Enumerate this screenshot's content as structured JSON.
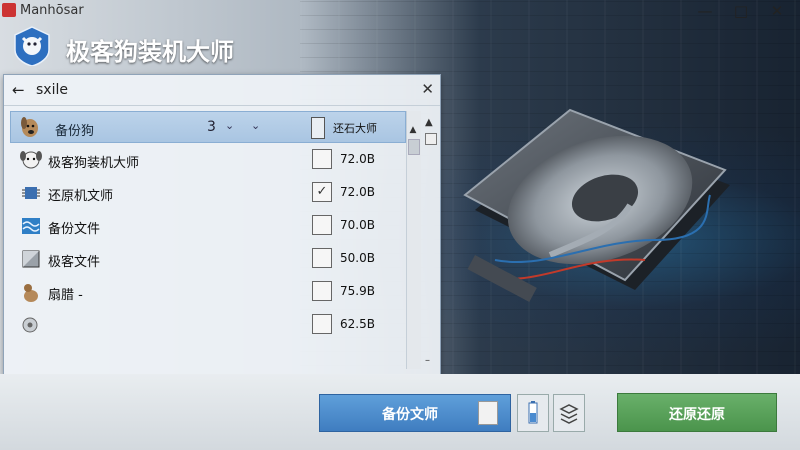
{
  "window": {
    "app_name": "Manhōsar",
    "controls": {
      "minimize": "—",
      "maximize": "□",
      "close": "✕"
    }
  },
  "brand": {
    "title": "极客狗装机大师"
  },
  "panel": {
    "back_icon": "←",
    "title": "sxile",
    "close_icon": "✕",
    "selected_row": {
      "label": "备份狗",
      "count": "3",
      "chevron1": "⌄",
      "chevron2": "⌄",
      "column_label": "还石大师"
    },
    "rows": [
      {
        "icon": "dog-face-icon",
        "label": "极客狗装机大师",
        "checked": false,
        "size": "72.0B"
      },
      {
        "icon": "chip-icon",
        "label": "还原机文师",
        "checked": true,
        "size": "72.0B"
      },
      {
        "icon": "wave-file-icon",
        "label": "备份文件",
        "checked": false,
        "size": "70.0B"
      },
      {
        "icon": "cube-icon",
        "label": "极客文件",
        "checked": false,
        "size": "50.0B"
      },
      {
        "icon": "dog-sit-icon",
        "label": "扇腊 -",
        "checked": false,
        "size": "75.9B"
      },
      {
        "icon": "gear-badge-icon",
        "label": "",
        "checked": false,
        "size": "62.5B"
      }
    ],
    "check_mark": "✓",
    "scroll": {
      "up": "▲",
      "down": "–"
    }
  },
  "bottom": {
    "backup_button": "备份文师",
    "restore_button": "还原还原"
  },
  "colors": {
    "accent_blue": "#4a8bd0",
    "accent_green": "#5aa35b",
    "window_bg": "#eef2f6"
  }
}
